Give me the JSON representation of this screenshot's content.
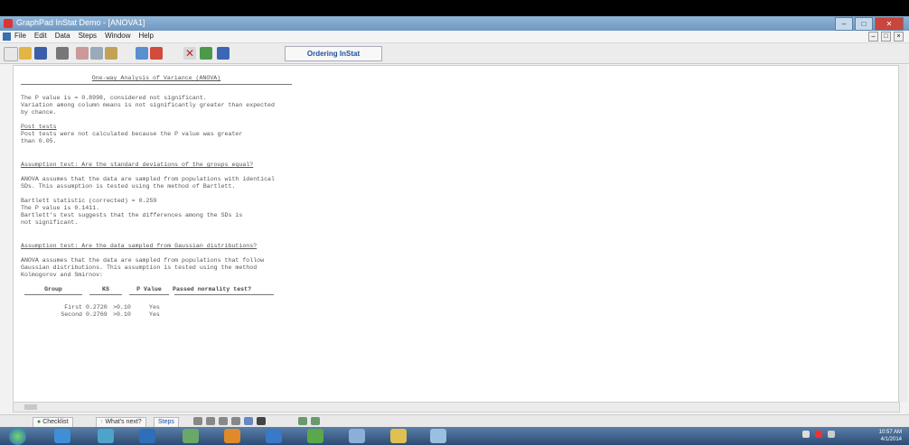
{
  "window": {
    "title": "GraphPad InStat Demo - [ANOVA1]",
    "controls": [
      "–",
      "□",
      "✕"
    ]
  },
  "menubar": {
    "items": [
      "File",
      "Edit",
      "Data",
      "Steps",
      "Window",
      "Help"
    ],
    "mdi_controls": [
      "–",
      "□",
      "×"
    ]
  },
  "toolbar": {
    "ordering_label": "Ordering InStat"
  },
  "results": {
    "title": "One-way Analysis of Variance (ANOVA)",
    "p_line1": "The P value is = 0.8998, considered not significant.",
    "p_line2": "Variation among column means is not significantly greater than expected",
    "p_line3": "by chance.",
    "post_heading": "Post tests",
    "post_line1": "Post tests were not calculated because the P value was greater",
    "post_line2": "than 0.05.",
    "sd_heading": "Assumption test: Are the standard deviations of the groups equal?",
    "sd_line1": "ANOVA assumes that the data are sampled from populations with identical",
    "sd_line2": "SDs. This assumption is tested using the method of Bartlett.",
    "bart_line1": "Bartlett statistic (corrected) = 0.259",
    "bart_line2": "The P value is 0.1411.",
    "bart_line3": "Bartlett's test suggests that the differences among the SDs is",
    "bart_line4": "not significant.",
    "gauss_heading": "Assumption test: Are the data sampled from Gaussian distributions?",
    "gauss_line1": "ANOVA assumes that the data are sampled from populations that follow",
    "gauss_line2": "Gaussian distributions. This assumption is tested using the method",
    "gauss_line3": "Kolmogorov and Smirnov:",
    "table": {
      "headers": [
        "Group",
        "KS",
        "P Value",
        "Passed normality test?"
      ],
      "rows": [
        [
          "First",
          "0.2720",
          ">0.10",
          "Yes"
        ],
        [
          "Second",
          "0.2769",
          ">0.10",
          "Yes"
        ]
      ]
    }
  },
  "sheetbar": {
    "checklist": "Checklist",
    "whats_next": "What's next?",
    "steps": "Steps"
  },
  "tray": {
    "time": "10:57 AM",
    "date": "4/1/2014"
  }
}
